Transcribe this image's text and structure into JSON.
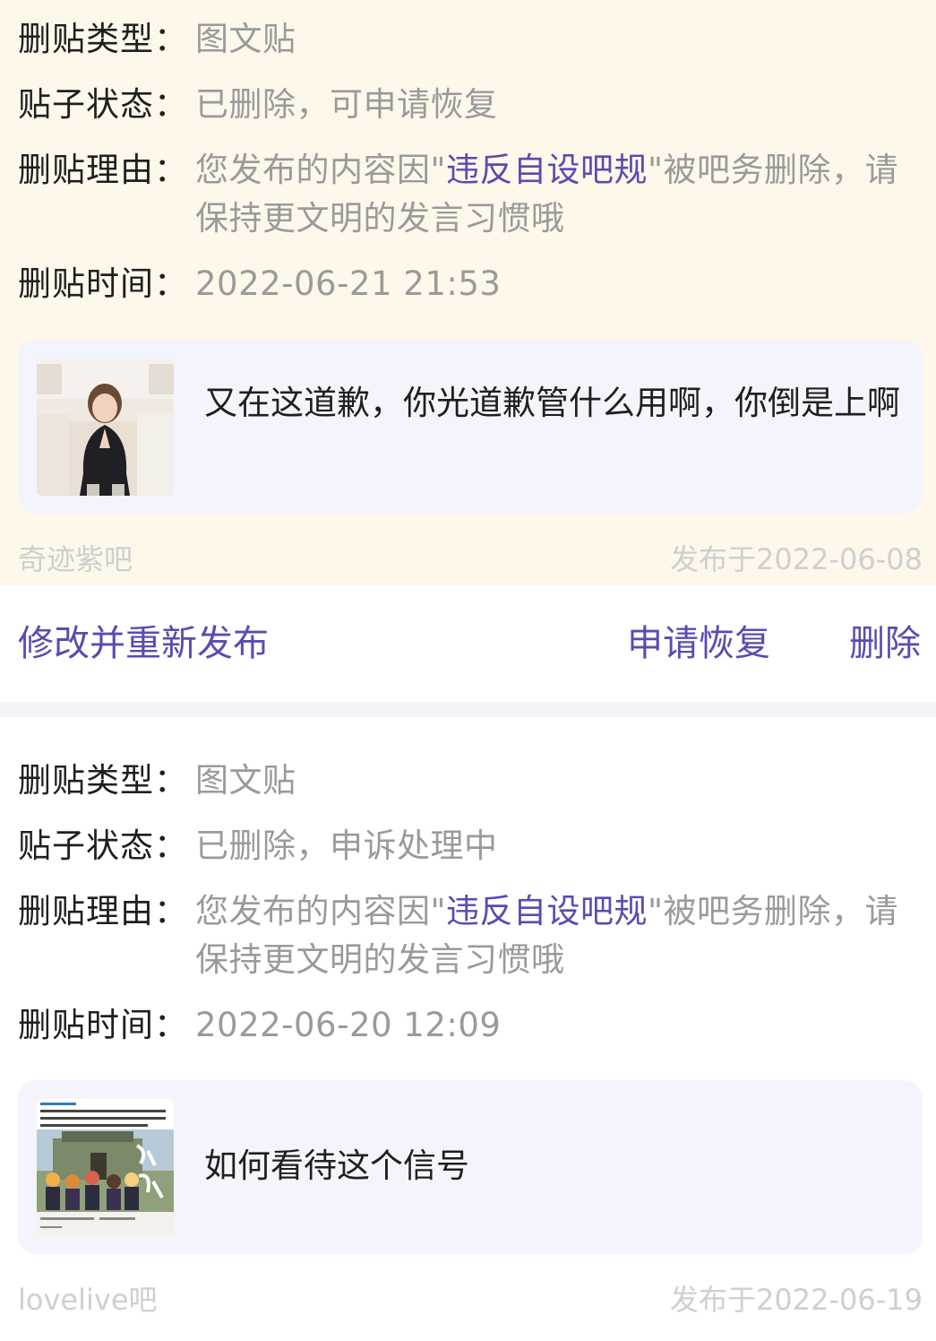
{
  "records": [
    {
      "type_label": "删贴类型：",
      "type_value": "图文贴",
      "status_label": "贴子状态：",
      "status_value": "已删除，可申请恢复",
      "reason_label": "删贴理由：",
      "reason_prefix": "您发布的内容因\"",
      "reason_link": "违反自设吧规",
      "reason_suffix": "\"被吧务删除，请保持更文明的发言习惯哦",
      "time_label": "删贴时间：",
      "time_value": "2022-06-21 21:53",
      "post_text": "又在这道歉，你光道歉管什么用啊，你倒是上啊",
      "forum": "奇迹紫吧",
      "published": "发布于2022-06-08"
    },
    {
      "type_label": "删贴类型：",
      "type_value": "图文贴",
      "status_label": "贴子状态：",
      "status_value": "已删除，申诉处理中",
      "reason_label": "删贴理由：",
      "reason_prefix": "您发布的内容因\"",
      "reason_link": "违反自设吧规",
      "reason_suffix": "\"被吧务删除，请保持更文明的发言习惯哦",
      "time_label": "删贴时间：",
      "time_value": "2022-06-20 12:09",
      "post_text": "如何看待这个信号",
      "forum": "lovelive吧",
      "published": "发布于2022-06-19"
    }
  ],
  "actions": {
    "edit_republish": "修改并重新发布",
    "apply_restore": "申请恢复",
    "delete": "删除"
  },
  "colors": {
    "accent": "#5b4bb0",
    "record_bg_highlight": "#fdf8e9",
    "card_bg": "#f4f4fc"
  }
}
